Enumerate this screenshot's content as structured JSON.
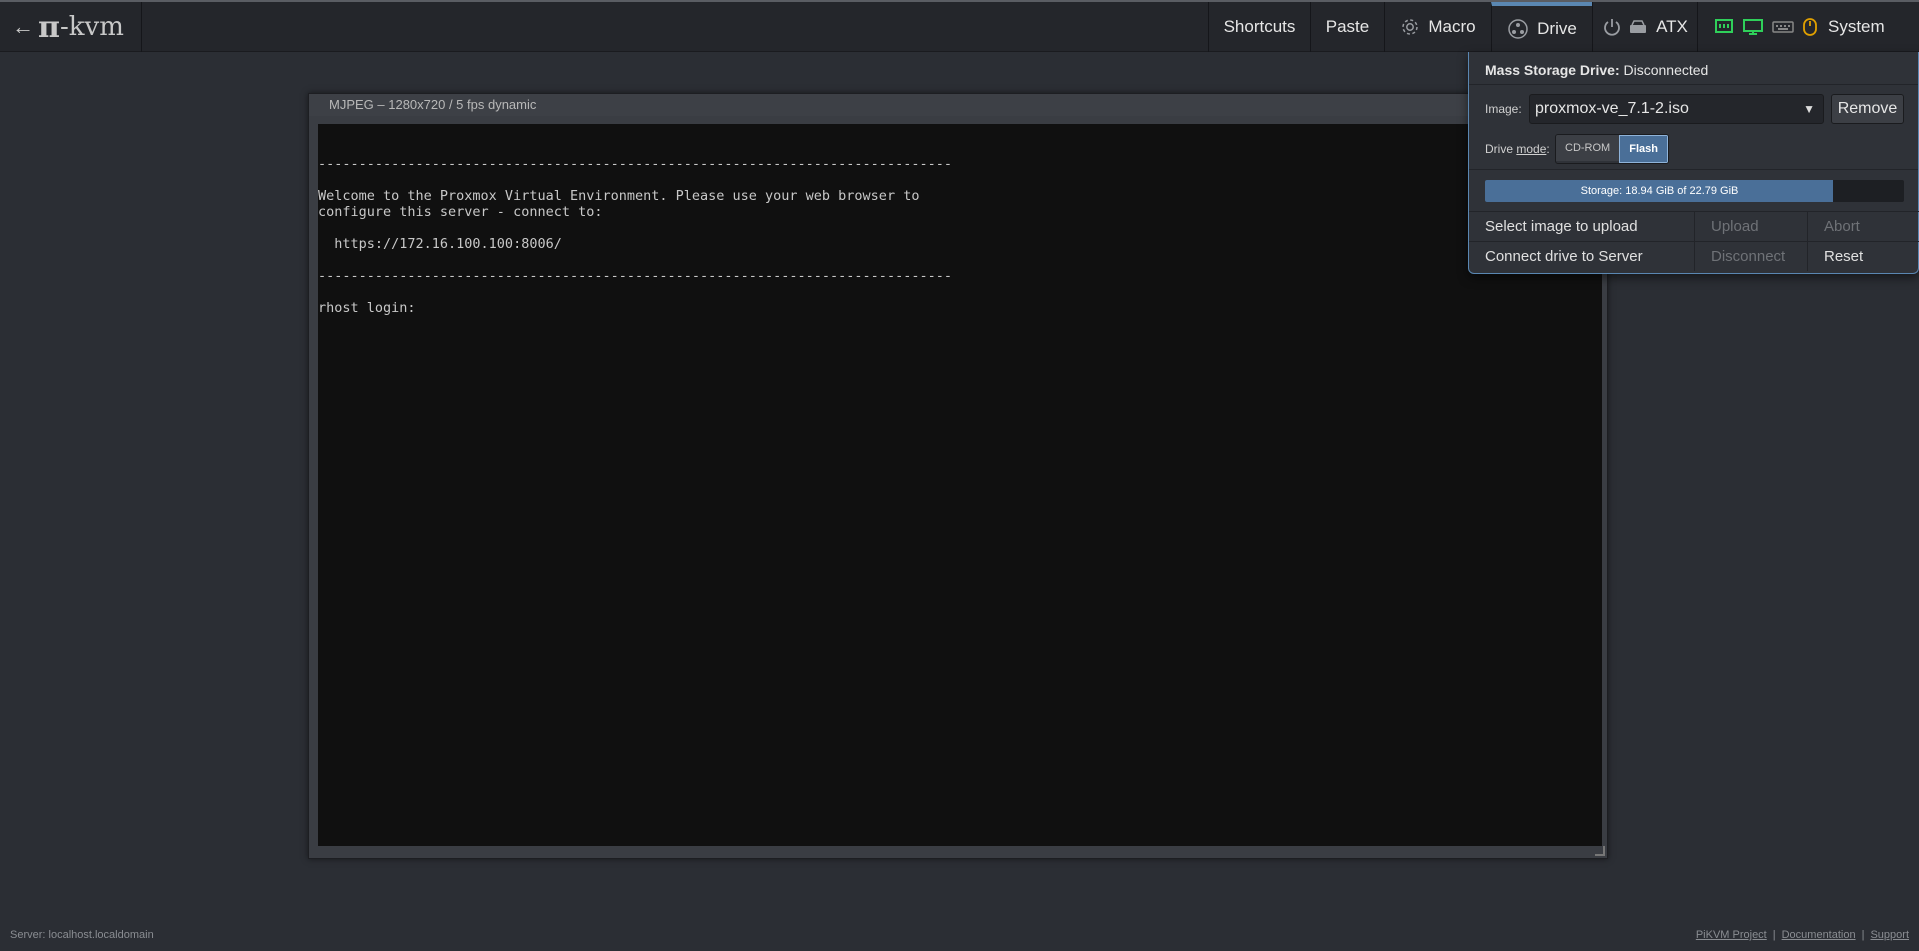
{
  "logo": {
    "arrow": "←",
    "pi": "π",
    "suffix": "-kvm"
  },
  "menu": {
    "shortcuts": "Shortcuts",
    "paste": "Paste",
    "macro": "Macro",
    "drive": "Drive",
    "atx": "ATX",
    "system": "System"
  },
  "icons": {
    "macro": "gear-icon",
    "drive": "drive-icon",
    "atx_power": "power-icon",
    "atx_hdd": "hdd-icon",
    "status_network": "network-icon",
    "status_monitor": "monitor-icon",
    "status_keyboard": "keyboard-icon",
    "status_mouse": "mouse-icon"
  },
  "colors": {
    "accent": "#5a87b2",
    "network_ok": "#2fd05a",
    "monitor_ok": "#2fd05a",
    "keyboard_off": "#888888",
    "mouse_warn": "#e0a000"
  },
  "stream": {
    "header": "MJPEG – 1280x720 / 5 fps dynamic",
    "fullscreen_icon": "⤢",
    "console": "------------------------------------------------------------------------------\n\nWelcome to the Proxmox Virtual Environment. Please use your web browser to\nconfigure this server - connect to:\n\n  https://172.16.100.100:8006/\n\n------------------------------------------------------------------------------\n\nrhost login: "
  },
  "drive": {
    "title_label": "Mass Storage Drive:",
    "status": "Disconnected",
    "image_label": "Image:",
    "image_value": "proxmox-ve_7.1-2.iso",
    "remove": "Remove",
    "mode_label_prefix": "Drive ",
    "mode_label_word": "mode",
    "mode_label_suffix": ":",
    "mode_cdrom": "CD-ROM",
    "mode_flash": "Flash",
    "selected_mode": "Flash",
    "storage_text": "Storage: 18.94 GiB of 22.79 GiB",
    "storage_used_gib": 18.94,
    "storage_total_gib": 22.79,
    "select_upload": "Select image to upload",
    "upload": "Upload",
    "abort": "Abort",
    "connect": "Connect drive to Server",
    "disconnect": "Disconnect",
    "reset": "Reset"
  },
  "footer": {
    "server": "Server: localhost.localdomain",
    "links": [
      "PiKVM Project",
      "Documentation",
      "Support"
    ]
  }
}
